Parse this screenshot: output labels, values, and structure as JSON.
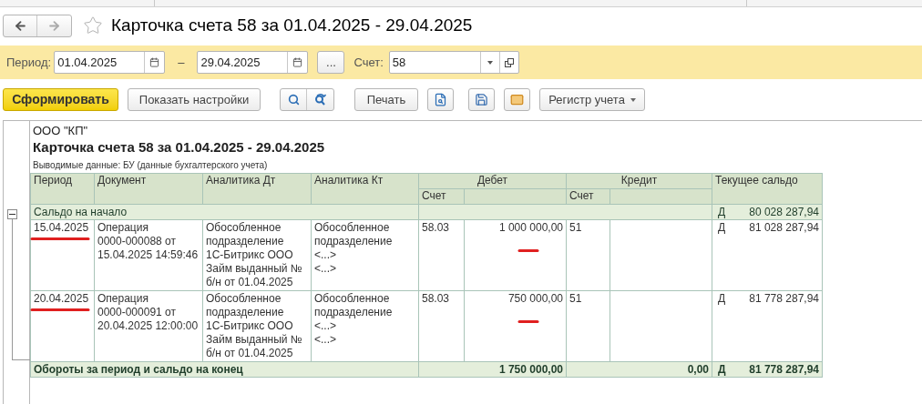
{
  "window": {
    "title": "Карточка счета 58 за 01.04.2025 - 29.04.2025",
    "favorite": false
  },
  "filter": {
    "period_label": "Период:",
    "date_from": "01.04.2025",
    "dash": "–",
    "date_to": "29.04.2025",
    "more_button": "...",
    "account_label": "Счет:",
    "account": "58"
  },
  "toolbar": {
    "generate": "Сформировать",
    "show_settings": "Показать настройки",
    "print": "Печать",
    "register": "Регистр учета"
  },
  "report": {
    "org": "ООО \"КП\"",
    "title": "Карточка счета 58 за 01.04.2025 - 29.04.2025",
    "subtitle": "Выводимые данные: БУ (данные бухгалтерского учета)",
    "expanded": true,
    "columns": [
      "Период",
      "Документ",
      "Аналитика Дт",
      "Аналитика Кт",
      "Дебет",
      "Кредит",
      "Текущее сальдо"
    ],
    "subcolumns": [
      "Счет",
      "Счет"
    ],
    "opening": {
      "label": "Сальдо на начало",
      "side": "Д",
      "balance": "80 028 287,94"
    },
    "rows": [
      {
        "period": "15.04.2025",
        "document": [
          "Операция",
          "0000-000088 от",
          "15.04.2025 14:59:46"
        ],
        "analytics_dt": [
          "Обособленное",
          "подразделение",
          "1С-Битрикс ООО",
          "Займ выданный №",
          "б/н от 01.04.2025"
        ],
        "analytics_kt": [
          "Обособленное",
          "подразделение",
          "<...>",
          "<...>"
        ],
        "debit_account": "58.03",
        "debit_amount": "1 000 000,00",
        "credit_account": "51",
        "side": "Д",
        "balance": "81 028 287,94"
      },
      {
        "period": "20.04.2025",
        "document": [
          "Операция",
          "0000-000091 от",
          "20.04.2025 12:00:00"
        ],
        "analytics_dt": [
          "Обособленное",
          "подразделение",
          "1С-Битрикс ООО",
          "Займ выданный №",
          "б/н от 01.04.2025"
        ],
        "analytics_kt": [
          "Обособленное",
          "подразделение",
          "<...>",
          "<...>"
        ],
        "debit_account": "58.03",
        "debit_amount": "750 000,00",
        "credit_account": "51",
        "side": "Д",
        "balance": "81 778 287,94"
      }
    ],
    "totals": {
      "label": "Обороты за период и сальдо на конец",
      "debit": "1 750 000,00",
      "credit": "0,00",
      "side": "Д",
      "balance": "81 778 287,94"
    }
  }
}
